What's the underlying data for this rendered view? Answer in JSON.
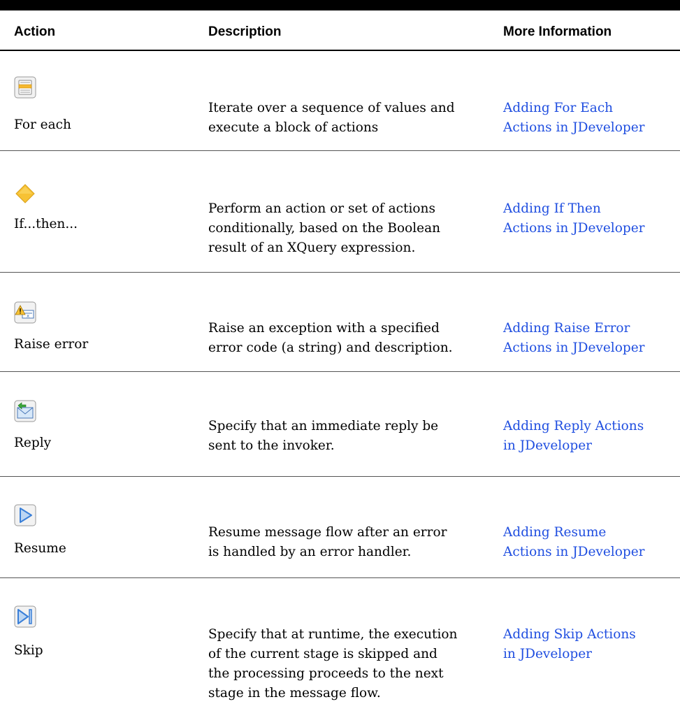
{
  "table": {
    "headers": {
      "action": "Action",
      "description": "Description",
      "more_info": "More Information"
    },
    "rows": [
      {
        "icon": "for-each-icon",
        "action": "For each",
        "description": [
          "Iterate over a sequence of values and",
          "execute a block of actions"
        ],
        "link": [
          "Adding For Each",
          "Actions in JDeveloper"
        ]
      },
      {
        "icon": "if-then-diamond-icon",
        "action": "If...then...",
        "description": [
          "Perform an action or set of actions",
          "conditionally, based on the Boolean",
          "result of an XQuery expression."
        ],
        "link": [
          "Adding If Then",
          "Actions in JDeveloper"
        ]
      },
      {
        "icon": "raise-error-warning-icon",
        "action": "Raise error",
        "description": [
          "Raise an exception with a specified",
          "error code (a string) and description."
        ],
        "link": [
          "Adding Raise Error",
          "Actions in JDeveloper"
        ]
      },
      {
        "icon": "reply-envelope-icon",
        "action": "Reply",
        "description": [
          "Specify that an immediate reply be",
          "sent to the invoker."
        ],
        "link": [
          "Adding Reply Actions",
          "in JDeveloper"
        ]
      },
      {
        "icon": "resume-play-icon",
        "action": "Resume",
        "description": [
          "Resume message flow after an error",
          "is handled by an error handler."
        ],
        "link": [
          "Adding Resume",
          "Actions in JDeveloper"
        ]
      },
      {
        "icon": "skip-next-icon",
        "action": "Skip",
        "description": [
          "Specify that at runtime, the execution",
          "of the current stage is skipped and",
          "the processing proceeds to the next",
          "stage in the message flow."
        ],
        "link": [
          "Adding Skip Actions",
          "in JDeveloper"
        ]
      }
    ]
  },
  "colors": {
    "link": "#1f4ee0",
    "icon_blue": "#3a7fd8",
    "diamond": "#f7c234"
  }
}
